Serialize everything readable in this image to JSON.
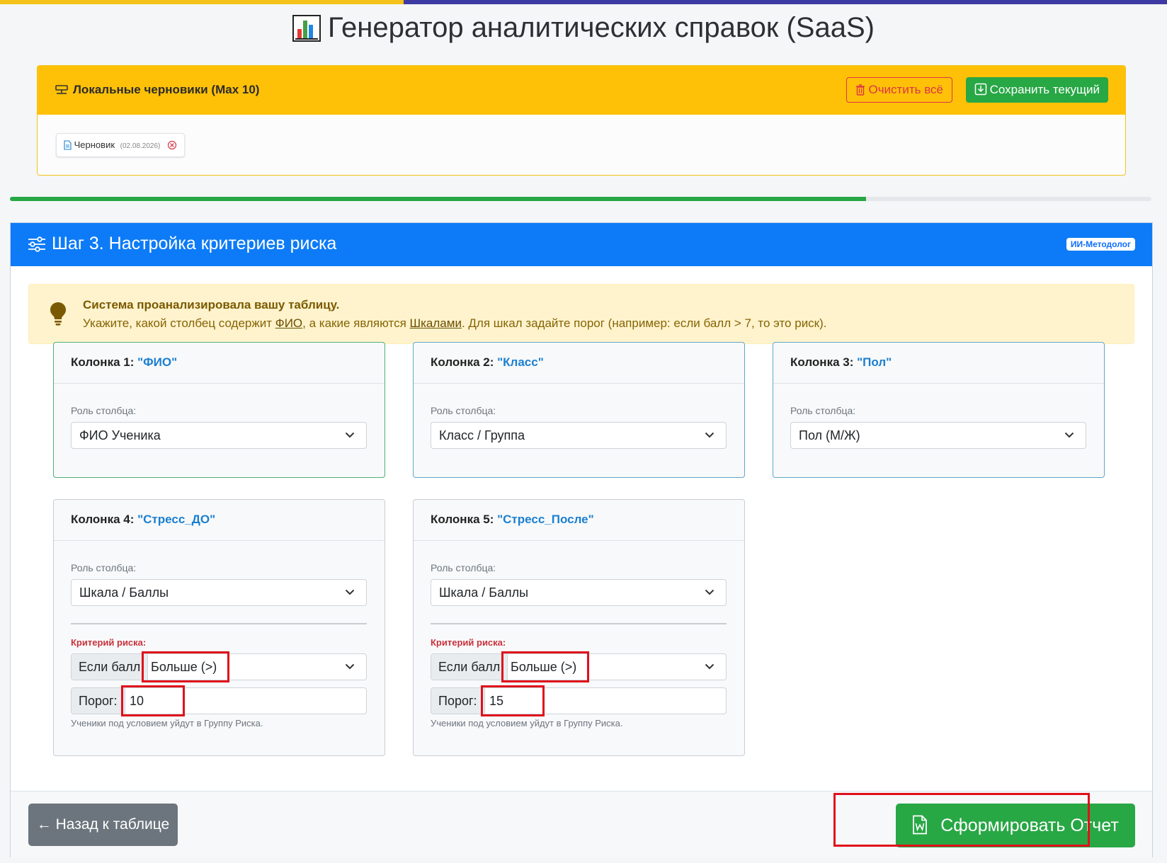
{
  "page": {
    "title": "Генератор аналитических справок (SaaS)"
  },
  "drafts": {
    "title": "Локальные черновики (Max 10)",
    "clear_label": "Очистить всё",
    "save_label": "Сохранить текущий",
    "items": [
      {
        "name": "Черновик",
        "date": "(02.08.2026)"
      }
    ]
  },
  "progress": {
    "percent": 75
  },
  "step": {
    "title": "Шаг 3. Настройка критериев риска",
    "badge": "ИИ-Методолог",
    "alert": {
      "heading": "Система проанализировала вашу таблицу.",
      "text_1": "Укажите, какой столбец содержит ",
      "link_fio": "ФИО",
      "text_2": ", а какие являются ",
      "link_scales": "Шкалами",
      "text_3": ". Для шкал задайте порог (например: если балл > 7, то это риск)."
    },
    "role_label": "Роль столбца:",
    "risk_label": "Критерий риска:",
    "if_score_label": "Если балл",
    "threshold_label": "Порог:",
    "hint": "Ученики под условием уйдут в Группу Риска.",
    "columns": [
      {
        "prefix": "Колонка 1: ",
        "name": "\"ФИО\"",
        "role": "ФИО Ученика"
      },
      {
        "prefix": "Колонка 2: ",
        "name": "\"Класс\"",
        "role": "Класс / Группа"
      },
      {
        "prefix": "Колонка 3: ",
        "name": "\"Пол\"",
        "role": "Пол (М/Ж)"
      },
      {
        "prefix": "Колонка 4: ",
        "name": "\"Стресс_ДО\"",
        "role": "Шкала / Баллы",
        "operator": "Больше (>)",
        "threshold": "10"
      },
      {
        "prefix": "Колонка 5: ",
        "name": "\"Стресс_После\"",
        "role": "Шкала / Баллы",
        "operator": "Больше (>)",
        "threshold": "15"
      }
    ],
    "back_label": "← Назад к таблице",
    "generate_label": "Сформировать Отчет"
  },
  "colors": {
    "primary": "#0d7bf7",
    "success": "#28a745",
    "warning": "#ffc107",
    "danger": "#dc3545"
  }
}
